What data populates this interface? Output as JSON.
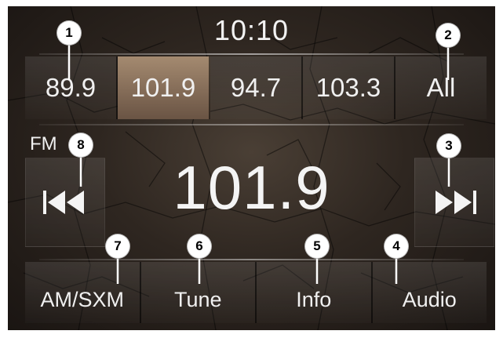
{
  "clock": "10:10",
  "presets": [
    "89.9",
    "101.9",
    "94.7",
    "103.3"
  ],
  "all_label": "All",
  "active_preset_index": 1,
  "band": "FM",
  "frequency": "101.9",
  "bottom_buttons": [
    "AM/SXM",
    "Tune",
    "Info",
    "Audio"
  ],
  "callouts": {
    "c1": "1",
    "c2": "2",
    "c3": "3",
    "c4": "4",
    "c5": "5",
    "c6": "6",
    "c7": "7",
    "c8": "8"
  },
  "icons": {
    "seek_back": "seek-back-icon",
    "seek_forward": "seek-forward-icon"
  }
}
